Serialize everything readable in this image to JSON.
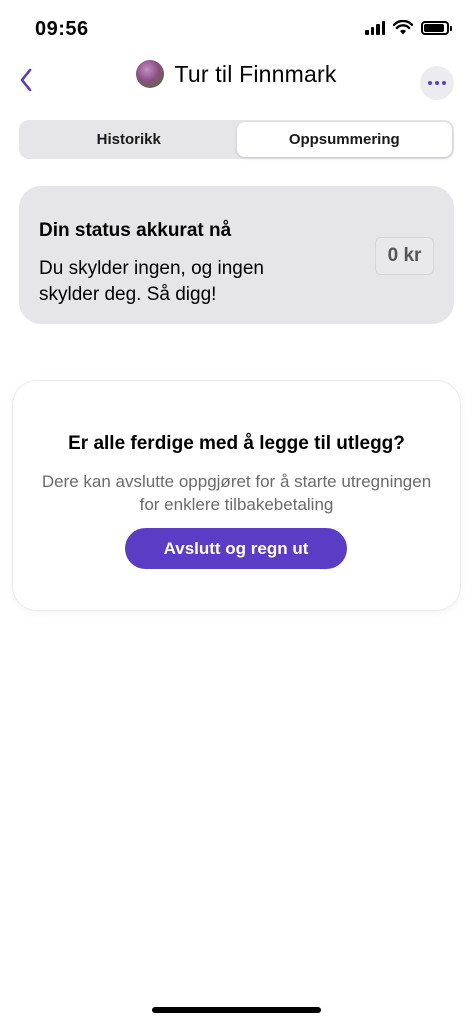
{
  "status_bar": {
    "time": "09:56",
    "icons": [
      "cellular-signal-icon",
      "wifi-icon",
      "battery-icon"
    ]
  },
  "nav": {
    "back_icon": "chevron-left-icon",
    "title": "Tur til Finnmark",
    "more_icon": "ellipsis-icon"
  },
  "tabs": [
    {
      "label": "Historikk",
      "active": false
    },
    {
      "label": "Oppsummering",
      "active": true
    }
  ],
  "status_card": {
    "heading": "Din status akkurat nå",
    "text": "Du skylder ingen, og ingen skylder deg. Så digg!",
    "amount": "0 kr"
  },
  "finish_card": {
    "heading": "Er alle ferdige med å legge til utlegg?",
    "subtitle": "Dere kan avslutte oppgjøret for å starte utregningen for enklere tilbakebetaling",
    "button_label": "Avslutt og regn ut"
  },
  "colors": {
    "accent": "#5b3cc4",
    "card_bg": "#e6e6e9",
    "muted_text": "#6b6b6b"
  }
}
